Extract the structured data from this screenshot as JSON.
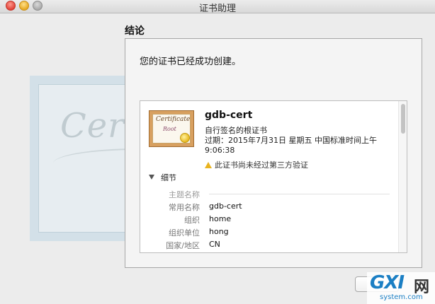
{
  "window": {
    "title": "证书助理"
  },
  "section": {
    "heading": "结论"
  },
  "main": {
    "success_message": "您的证书已经成功创建。"
  },
  "background": {
    "script_text": "Certif"
  },
  "certificate": {
    "icon_line1": "Certificate",
    "icon_line2": "Root",
    "name": "gdb-cert",
    "type": "自行签名的根证书",
    "expiry": "过期：2015年7月31日 星期五 中国标准时间上午 9:06:38",
    "warning": "此证书尚未经过第三方验证",
    "details_label": "细节",
    "subject_header": "主题名称",
    "fields": [
      {
        "label": "常用名称",
        "value": "gdb-cert"
      },
      {
        "label": "组织",
        "value": "home"
      },
      {
        "label": "组织单位",
        "value": "hong"
      },
      {
        "label": "国家/地区",
        "value": "CN"
      }
    ]
  },
  "logo": {
    "brand": "GXI",
    "brand_cn": "网",
    "url": "system.com"
  }
}
